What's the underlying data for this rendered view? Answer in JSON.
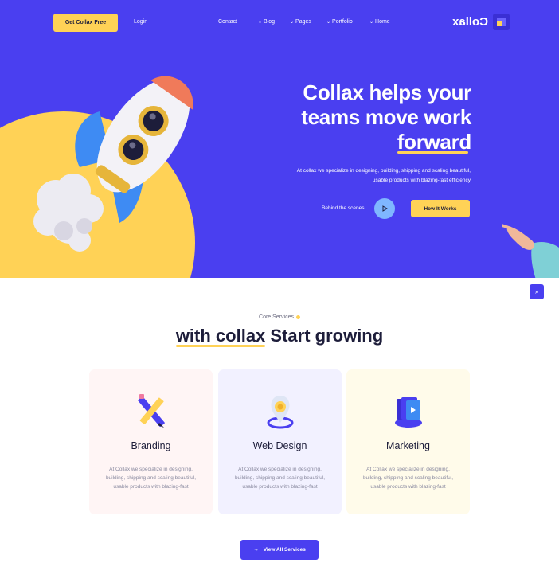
{
  "nav": {
    "cta_label": "Get Collax Free",
    "login_label": "Login",
    "menu": [
      {
        "label": "Contact",
        "has_dropdown": false
      },
      {
        "label": "Blog",
        "has_dropdown": true
      },
      {
        "label": "Pages",
        "has_dropdown": true
      },
      {
        "label": "Portfolio",
        "has_dropdown": true
      },
      {
        "label": "Home",
        "has_dropdown": true
      }
    ],
    "logo_text": "Collax"
  },
  "hero": {
    "title_line1": "Collax helps your",
    "title_line2": "teams move work",
    "title_line3": "forward",
    "description": "At collax we specialize in designing, building, shipping and scaling beautiful, usable products with blazing-fast efficiency",
    "behind_label": "Behind the scenes",
    "how_label": "How It Works"
  },
  "services": {
    "kicker": "Core Services",
    "title_part1": "with collax",
    "title_part2": " Start growing",
    "cards": [
      {
        "title": "Branding",
        "text": "At Collax we specialize in designing, building, shipping and scaling beautiful, usable products with blazing-fast",
        "icon": "pencil-ruler-icon",
        "bg": "#fff5f5"
      },
      {
        "title": "Web Design",
        "text": "At Collax we specialize in designing, building, shipping and scaling beautiful, usable products with blazing-fast",
        "icon": "location-pin-icon",
        "bg": "#f2f1ff"
      },
      {
        "title": "Marketing",
        "text": "At Collax we specialize in designing, building, shipping and scaling beautiful, usable products with blazing-fast",
        "icon": "media-stack-icon",
        "bg": "#fffbea"
      }
    ],
    "view_all_label": "View All Services"
  },
  "colors": {
    "primary": "#4a3ff0",
    "accent": "#ffd256"
  }
}
